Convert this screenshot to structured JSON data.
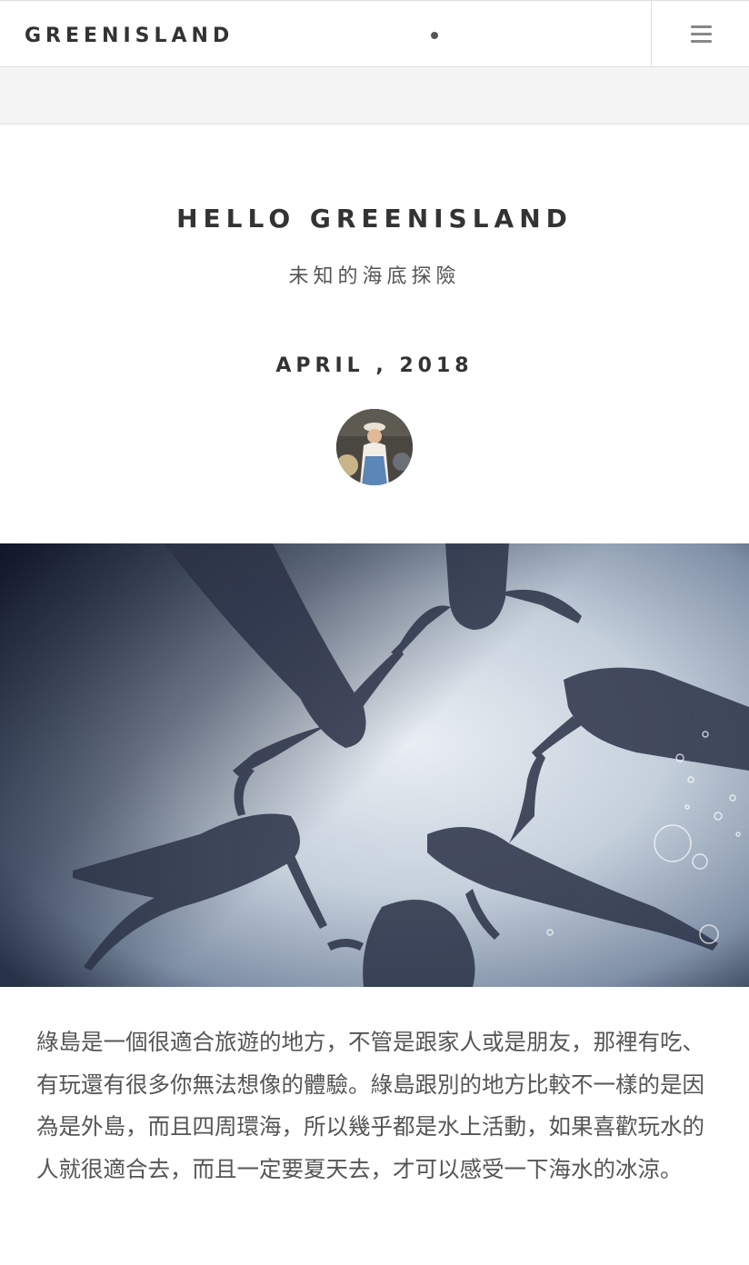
{
  "header": {
    "brand": "GREENISLAND",
    "menu_icon": "hamburger-menu-icon"
  },
  "post": {
    "title": "HELLO GREENISLAND",
    "subtitle": "未知的海底探險",
    "date": "APRIL , 2018",
    "body": "綠島是一個很適合旅遊的地方，不管是跟家人或是朋友，那裡有吃、有玩還有很多你無法想像的體驗。綠島跟別的地方比較不一樣的是因為是外島，而且四周環海，所以幾乎都是水上活動，如果喜歡玩水的人就很適合去，而且一定要夏天去，才可以感受一下海水的冰涼。"
  },
  "colors": {
    "text": "#333333",
    "muted": "#555555",
    "subbar": "#f4f4f4",
    "border": "#dddddd"
  }
}
